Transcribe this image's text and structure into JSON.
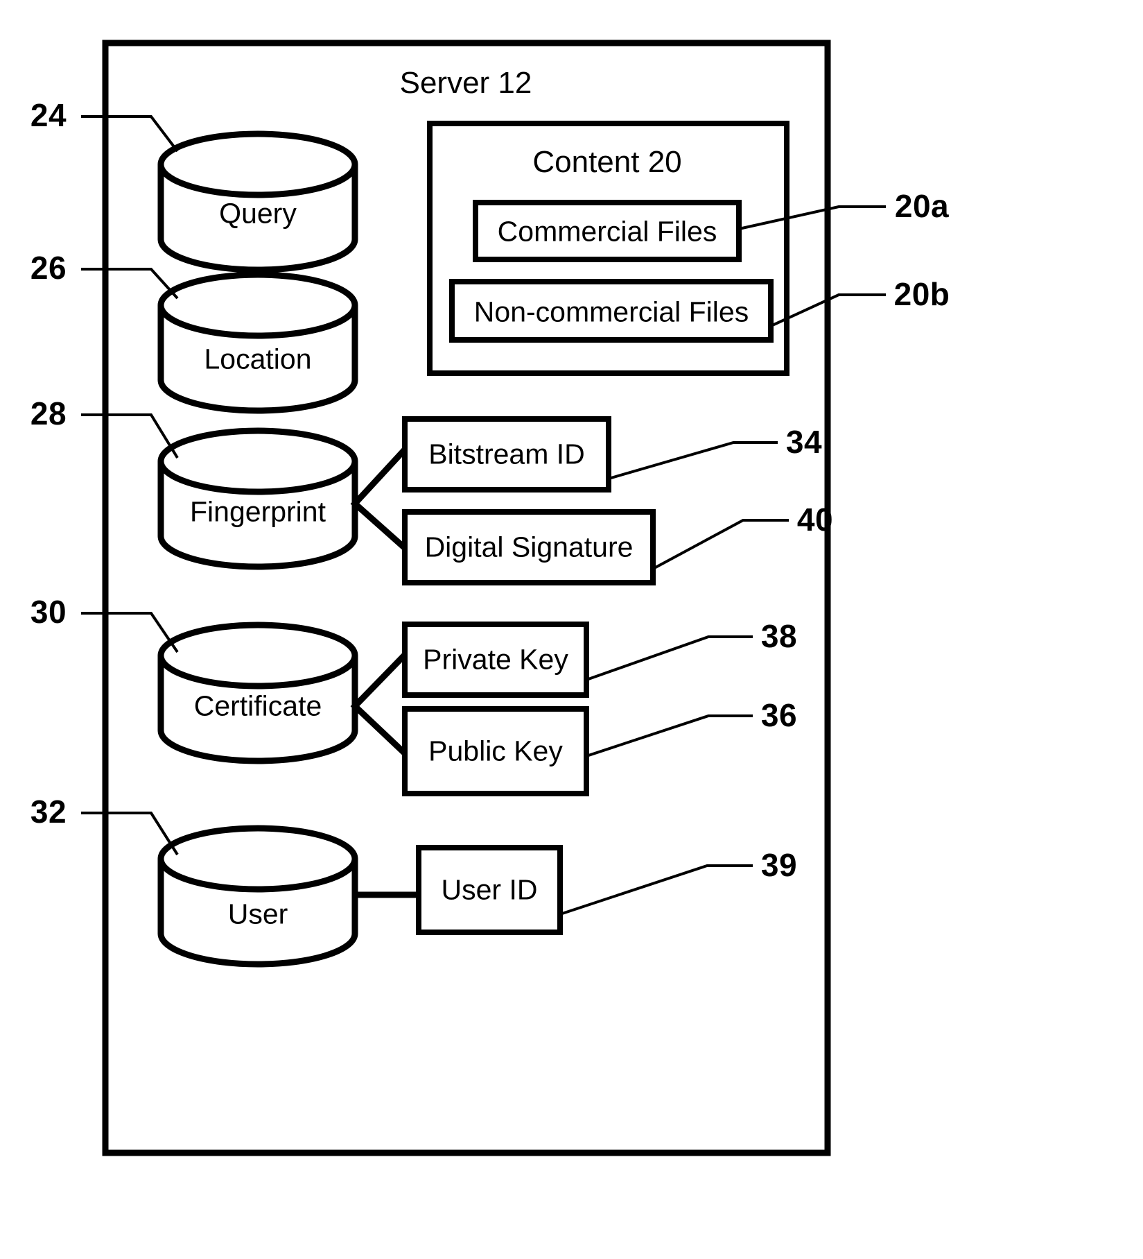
{
  "figure": {
    "type": "patent-block-diagram",
    "background": "#ffffff",
    "stroke_color": "#000000"
  },
  "server": {
    "title": "Server",
    "ref": "12",
    "title_full": "Server   12"
  },
  "content_group": {
    "title": "Content",
    "ref": "20",
    "title_full": "Content  20",
    "items": [
      {
        "label": "Commercial Files",
        "ref": "20a"
      },
      {
        "label": "Non-commercial Files",
        "ref": "20b"
      }
    ]
  },
  "databases": [
    {
      "label": "Query",
      "ref": "24",
      "attributes": []
    },
    {
      "label": "Location",
      "ref": "26",
      "attributes": []
    },
    {
      "label": "Fingerprint",
      "ref": "28",
      "attributes": [
        {
          "label": "Bitstream ID",
          "ref": "34"
        },
        {
          "label": "Digital Signature",
          "ref": "40"
        }
      ]
    },
    {
      "label": "Certificate",
      "ref": "30",
      "attributes": [
        {
          "label": "Private Key",
          "ref": "38"
        },
        {
          "label": "Public Key",
          "ref": "36"
        }
      ]
    },
    {
      "label": "User",
      "ref": "32",
      "attributes": [
        {
          "label": "User ID",
          "ref": "39"
        }
      ]
    }
  ],
  "reference_numerals": {
    "left": [
      "24",
      "26",
      "28",
      "30",
      "32"
    ],
    "right": [
      "20a",
      "20b",
      "34",
      "40",
      "38",
      "36",
      "39"
    ]
  }
}
